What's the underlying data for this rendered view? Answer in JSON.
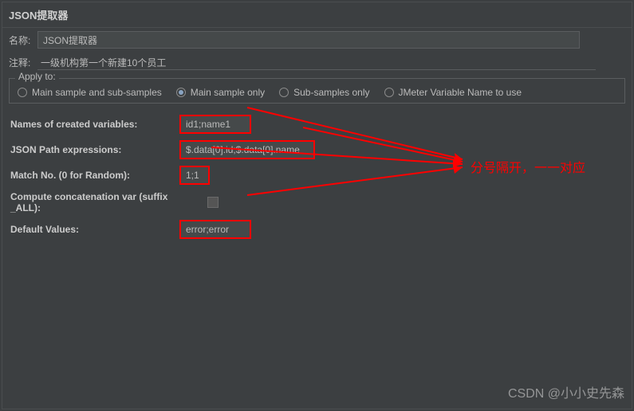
{
  "title": "JSON提取器",
  "name_label": "名称:",
  "name_value": "JSON提取器",
  "comment_label": "注释:",
  "comment_value": "一级机构第一个新建10个员工",
  "apply_to": {
    "legend": "Apply to:",
    "options": [
      "Main sample and sub-samples",
      "Main sample only",
      "Sub-samples only",
      "JMeter Variable Name to use"
    ],
    "selected_index": 1
  },
  "fields": {
    "names_label": "Names of created variables:",
    "names_value": "id1;name1",
    "json_path_label": "JSON Path expressions:",
    "json_path_value": "$.data[0].id;$.data[0].name",
    "match_no_label": "Match No. (0 for Random):",
    "match_no_value": "1;1",
    "concat_label": "Compute concatenation var (suffix _ALL):",
    "default_label": "Default Values:",
    "default_value": "error;error"
  },
  "annotation_text": "分号隔开，一一对应",
  "watermark": "CSDN @小小史先森"
}
